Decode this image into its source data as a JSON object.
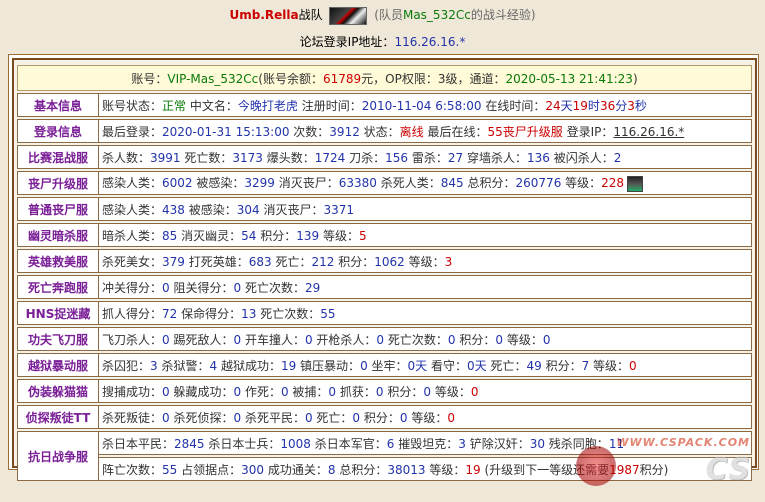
{
  "header": {
    "team_name": "Umb.Rella",
    "team_suffix": "战队",
    "member_note_prefix": "(队员",
    "member_name": "Mas_532Cc",
    "member_note_suffix": "的战斗经验)",
    "ip_label": "论坛登录IP地址：",
    "ip_value": "116.26.16.*"
  },
  "account": {
    "prefix": "账号：",
    "vip": "VIP-Mas_532Cc",
    "balance_label": "(账号余额：",
    "balance": "61789",
    "balance_unit": "元，OP权限：",
    "op_level": "3级",
    "channel_label": "，通道：",
    "channel_time": "2020-05-13 21:41:23",
    "close": ")"
  },
  "rows": [
    {
      "label": "基本信息",
      "parts": [
        {
          "t": "账号状态：",
          "c": "k"
        },
        {
          "t": "正常",
          "c": "g"
        },
        {
          "t": " 中文名：",
          "c": "k"
        },
        {
          "t": "今晚打老虎",
          "c": "n"
        },
        {
          "t": " 注册时间：",
          "c": "k"
        },
        {
          "t": "2010-11-04 6:58:00",
          "c": "n"
        },
        {
          "t": " 在线时间：",
          "c": "k"
        },
        {
          "t": "24",
          "c": "r"
        },
        {
          "t": "天",
          "c": "n"
        },
        {
          "t": "19",
          "c": "r"
        },
        {
          "t": "时",
          "c": "n"
        },
        {
          "t": "36",
          "c": "r"
        },
        {
          "t": "分",
          "c": "n"
        },
        {
          "t": "3",
          "c": "r"
        },
        {
          "t": "秒",
          "c": "n"
        }
      ]
    },
    {
      "label": "登录信息",
      "parts": [
        {
          "t": "最后登录：",
          "c": "k"
        },
        {
          "t": "2020-01-31 15:13:00",
          "c": "n"
        },
        {
          "t": " 次数：",
          "c": "k"
        },
        {
          "t": "3912",
          "c": "n"
        },
        {
          "t": " 状态：",
          "c": "k"
        },
        {
          "t": "离线",
          "c": "r"
        },
        {
          "t": " 最后在线：",
          "c": "k"
        },
        {
          "t": "55丧尸升级服",
          "c": "r"
        },
        {
          "t": " 登录IP：",
          "c": "k"
        },
        {
          "t": "116.26.16.*",
          "c": "link"
        }
      ]
    },
    {
      "label": "比赛混战服",
      "parts": [
        {
          "t": "杀人数：",
          "c": "k"
        },
        {
          "t": "3991",
          "c": "n"
        },
        {
          "t": " 死亡数：",
          "c": "k"
        },
        {
          "t": "3173",
          "c": "n"
        },
        {
          "t": " 爆头数：",
          "c": "k"
        },
        {
          "t": "1724",
          "c": "n"
        },
        {
          "t": " 刀杀：",
          "c": "k"
        },
        {
          "t": "156",
          "c": "n"
        },
        {
          "t": " 雷杀：",
          "c": "k"
        },
        {
          "t": "27",
          "c": "n"
        },
        {
          "t": " 穿墙杀人：",
          "c": "k"
        },
        {
          "t": "136",
          "c": "n"
        },
        {
          "t": " 被闪杀人：",
          "c": "k"
        },
        {
          "t": "2",
          "c": "n"
        }
      ]
    },
    {
      "label": "丧尸升级服",
      "avatar": true,
      "parts": [
        {
          "t": "感染人类：",
          "c": "k"
        },
        {
          "t": "6002",
          "c": "n"
        },
        {
          "t": " 被感染：",
          "c": "k"
        },
        {
          "t": "3299",
          "c": "n"
        },
        {
          "t": " 消灭丧尸：",
          "c": "k"
        },
        {
          "t": "63380",
          "c": "n"
        },
        {
          "t": " 杀死人类：",
          "c": "k"
        },
        {
          "t": "845",
          "c": "n"
        },
        {
          "t": " 总积分：",
          "c": "k"
        },
        {
          "t": "260776",
          "c": "n"
        },
        {
          "t": " 等级：",
          "c": "k"
        },
        {
          "t": "228",
          "c": "r"
        }
      ]
    },
    {
      "label": "普通丧尸服",
      "parts": [
        {
          "t": "感染人类：",
          "c": "k"
        },
        {
          "t": "438",
          "c": "n"
        },
        {
          "t": " 被感染：",
          "c": "k"
        },
        {
          "t": "304",
          "c": "n"
        },
        {
          "t": " 消灭丧尸：",
          "c": "k"
        },
        {
          "t": "3371",
          "c": "n"
        }
      ]
    },
    {
      "label": "幽灵暗杀服",
      "parts": [
        {
          "t": "暗杀人类：",
          "c": "k"
        },
        {
          "t": "85",
          "c": "n"
        },
        {
          "t": " 消灭幽灵：",
          "c": "k"
        },
        {
          "t": "54",
          "c": "n"
        },
        {
          "t": " 积分：",
          "c": "k"
        },
        {
          "t": "139",
          "c": "n"
        },
        {
          "t": " 等级：",
          "c": "k"
        },
        {
          "t": "5",
          "c": "r"
        }
      ]
    },
    {
      "label": "英雄救美服",
      "parts": [
        {
          "t": "杀死美女：",
          "c": "k"
        },
        {
          "t": "379",
          "c": "n"
        },
        {
          "t": " 打死英雄：",
          "c": "k"
        },
        {
          "t": "683",
          "c": "n"
        },
        {
          "t": " 死亡：",
          "c": "k"
        },
        {
          "t": "212",
          "c": "n"
        },
        {
          "t": " 积分：",
          "c": "k"
        },
        {
          "t": "1062",
          "c": "n"
        },
        {
          "t": " 等级：",
          "c": "k"
        },
        {
          "t": "3",
          "c": "r"
        }
      ]
    },
    {
      "label": "死亡奔跑服",
      "parts": [
        {
          "t": "冲关得分：",
          "c": "k"
        },
        {
          "t": "0",
          "c": "n"
        },
        {
          "t": " 阻关得分：",
          "c": "k"
        },
        {
          "t": "0",
          "c": "n"
        },
        {
          "t": " 死亡次数：",
          "c": "k"
        },
        {
          "t": "29",
          "c": "n"
        }
      ]
    },
    {
      "label": "HNS捉迷藏",
      "parts": [
        {
          "t": "抓人得分：",
          "c": "k"
        },
        {
          "t": "72",
          "c": "n"
        },
        {
          "t": " 保命得分：",
          "c": "k"
        },
        {
          "t": "13",
          "c": "n"
        },
        {
          "t": " 死亡次数：",
          "c": "k"
        },
        {
          "t": "55",
          "c": "n"
        }
      ]
    },
    {
      "label": "功夫飞刀服",
      "parts": [
        {
          "t": "飞刀杀人：",
          "c": "k"
        },
        {
          "t": "0",
          "c": "n"
        },
        {
          "t": " 踢死敌人：",
          "c": "k"
        },
        {
          "t": "0",
          "c": "n"
        },
        {
          "t": " 开车撞人：",
          "c": "k"
        },
        {
          "t": "0",
          "c": "n"
        },
        {
          "t": " 开枪杀人：",
          "c": "k"
        },
        {
          "t": "0",
          "c": "n"
        },
        {
          "t": " 死亡次数：",
          "c": "k"
        },
        {
          "t": "0",
          "c": "n"
        },
        {
          "t": " 积分：",
          "c": "k"
        },
        {
          "t": "0",
          "c": "n"
        },
        {
          "t": " 等级：",
          "c": "k"
        },
        {
          "t": "0",
          "c": "n"
        }
      ]
    },
    {
      "label": "越狱暴动服",
      "parts": [
        {
          "t": "杀囚犯：",
          "c": "k"
        },
        {
          "t": "3",
          "c": "n"
        },
        {
          "t": " 杀狱警：",
          "c": "k"
        },
        {
          "t": "4",
          "c": "n"
        },
        {
          "t": " 越狱成功：",
          "c": "k"
        },
        {
          "t": "19",
          "c": "n"
        },
        {
          "t": " 镇压暴动：",
          "c": "k"
        },
        {
          "t": "0",
          "c": "n"
        },
        {
          "t": " 坐牢：",
          "c": "k"
        },
        {
          "t": "0天",
          "c": "n"
        },
        {
          "t": " 看守：",
          "c": "k"
        },
        {
          "t": "0天",
          "c": "n"
        },
        {
          "t": " 死亡：",
          "c": "k"
        },
        {
          "t": "49",
          "c": "n"
        },
        {
          "t": " 积分：",
          "c": "k"
        },
        {
          "t": "7",
          "c": "n"
        },
        {
          "t": " 等级：",
          "c": "k"
        },
        {
          "t": "0",
          "c": "r"
        }
      ]
    },
    {
      "label": "伪装躲猫猫",
      "parts": [
        {
          "t": "搜捕成功：",
          "c": "k"
        },
        {
          "t": "0",
          "c": "n"
        },
        {
          "t": " 躲藏成功：",
          "c": "k"
        },
        {
          "t": "0",
          "c": "n"
        },
        {
          "t": " 作死：",
          "c": "k"
        },
        {
          "t": "0",
          "c": "n"
        },
        {
          "t": " 被捕：",
          "c": "k"
        },
        {
          "t": "0",
          "c": "n"
        },
        {
          "t": " 抓获：",
          "c": "k"
        },
        {
          "t": "0",
          "c": "n"
        },
        {
          "t": " 积分：",
          "c": "k"
        },
        {
          "t": "0",
          "c": "n"
        },
        {
          "t": " 等级：",
          "c": "k"
        },
        {
          "t": "0",
          "c": "r"
        }
      ]
    },
    {
      "label": "侦探叛徒TT",
      "parts": [
        {
          "t": "杀死叛徒：",
          "c": "k"
        },
        {
          "t": "0",
          "c": "n"
        },
        {
          "t": " 杀死侦探：",
          "c": "k"
        },
        {
          "t": "0",
          "c": "n"
        },
        {
          "t": " 杀死平民：",
          "c": "k"
        },
        {
          "t": "0",
          "c": "n"
        },
        {
          "t": " 死亡：",
          "c": "k"
        },
        {
          "t": "0",
          "c": "n"
        },
        {
          "t": " 积分：",
          "c": "k"
        },
        {
          "t": "0",
          "c": "n"
        },
        {
          "t": " 等级：",
          "c": "k"
        },
        {
          "t": "0",
          "c": "r"
        }
      ]
    }
  ],
  "war_row": {
    "label": "抗日战争服",
    "line1": [
      {
        "t": "杀日本平民：",
        "c": "k"
      },
      {
        "t": "2845",
        "c": "n"
      },
      {
        "t": " 杀日本士兵：",
        "c": "k"
      },
      {
        "t": "1008",
        "c": "n"
      },
      {
        "t": " 杀日本军官：",
        "c": "k"
      },
      {
        "t": "6",
        "c": "n"
      },
      {
        "t": " 摧毁坦克：",
        "c": "k"
      },
      {
        "t": "3",
        "c": "n"
      },
      {
        "t": " 铲除汉奸：",
        "c": "k"
      },
      {
        "t": "30",
        "c": "n"
      },
      {
        "t": " 残杀同胞：",
        "c": "k"
      },
      {
        "t": "11",
        "c": "n"
      }
    ],
    "line2": [
      {
        "t": "阵亡次数：",
        "c": "k"
      },
      {
        "t": "55",
        "c": "n"
      },
      {
        "t": " 占领据点：",
        "c": "k"
      },
      {
        "t": "300",
        "c": "n"
      },
      {
        "t": " 成功通关：",
        "c": "k"
      },
      {
        "t": "8",
        "c": "n"
      },
      {
        "t": " 总积分：",
        "c": "k"
      },
      {
        "t": "38013",
        "c": "n"
      },
      {
        "t": " 等级：",
        "c": "k"
      },
      {
        "t": "19",
        "c": "r"
      },
      {
        "t": " (升级到下一等级还需要",
        "c": "k"
      },
      {
        "t": "1987",
        "c": "r"
      },
      {
        "t": "积分)",
        "c": "k"
      }
    ]
  },
  "watermark": {
    "top": "WWW.CSPACK.COM",
    "main": "CS"
  },
  "colors": {
    "label_purple": "#7a1f96",
    "value_blue": "#2233aa",
    "value_red": "#cc0000",
    "status_green": "#0a7a0a",
    "frame_brown": "#7a4a1f"
  },
  "icons": {
    "team_logo": "umbrella-team-logo",
    "avatar": "player-avatar-icon"
  }
}
